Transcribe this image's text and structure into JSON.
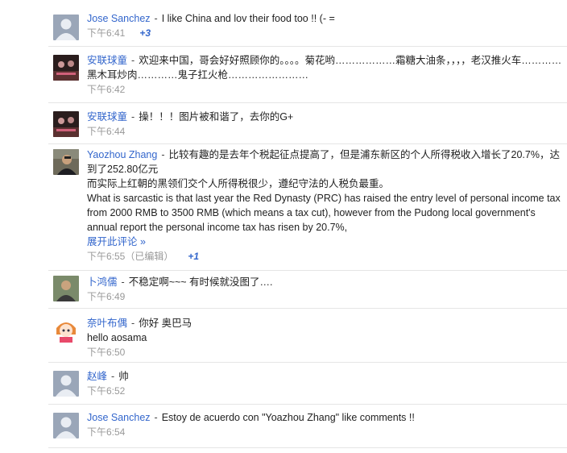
{
  "comments": [
    {
      "author": "Jose Sanchez",
      "text": "I like China and lov their food too !! (- =",
      "time": "下午6:41",
      "plus": "+3",
      "avatar": "default-avatar-icon"
    },
    {
      "author": "安联球童",
      "text": "欢迎来中国，哥会好好照顾你的。。。。菊花哟………………霜糖大油条，，，，老汉推火车…………黑木耳炒肉…………鬼子扛火枪……………………",
      "time": "下午6:42",
      "avatar": "photo-avatar-icon"
    },
    {
      "author": "安联球童",
      "text": "操！！！图片被和谐了，去你的G+",
      "time": "下午6:44",
      "avatar": "photo-avatar-icon"
    },
    {
      "author": "Yaozhou Zhang",
      "text_lines": [
        "比较有趣的是去年个税起征点提高了，但是浦东新区的个人所得税收入增长了20.7%，达到了252.80亿元",
        "而实际上红朝的黑领们交个人所得税很少，遵纪守法的人税负最重。",
        "What is sarcastic is that last year the Red Dynasty (PRC) has raised the entry level of personal income tax from 2000 RMB to 3500 RMB (which means a tax cut), however from the Pudong local government's annual report the personal income tax has risen by 20.7%,"
      ],
      "more_label": "展开此评论 »",
      "time": "下午6:55（已编辑）",
      "plus": "+1",
      "avatar": "photo-avatar-icon"
    },
    {
      "author": "卜鸿儒",
      "text": "不稳定啊~~~ 有时候就没图了….",
      "time": "下午6:49",
      "avatar": "photo-avatar-icon"
    },
    {
      "author": "奈叶布偶",
      "text": "你好 奥巴马",
      "text_line2": "hello aosama",
      "time": "下午6:50",
      "avatar": "anime-avatar-icon"
    },
    {
      "author": "赵峰",
      "text": "帅",
      "time": "下午6:52",
      "avatar": "default-avatar-icon"
    },
    {
      "author": "Jose Sanchez",
      "text": "Estoy de acuerdo con \"Yoazhou Zhang\" like comments !!",
      "time": "下午6:54",
      "avatar": "default-avatar-icon"
    }
  ],
  "colors": {
    "link": "#3366cc",
    "meta": "#999999",
    "divider": "#e5e5e5"
  }
}
